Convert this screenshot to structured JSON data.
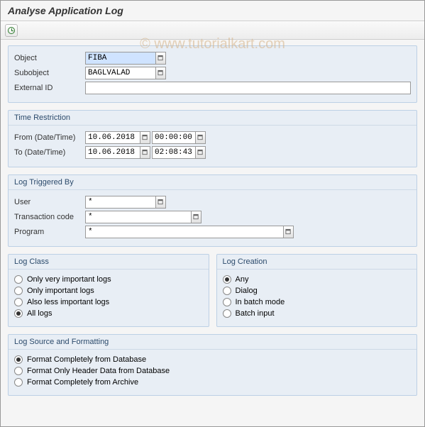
{
  "title": "Analyse Application Log",
  "watermark": "© www.tutorialkart.com",
  "fields": {
    "object_label": "Object",
    "object_value": "FIBA",
    "subobject_label": "Subobject",
    "subobject_value": "BAGLVALAD",
    "external_id_label": "External ID",
    "external_id_value": ""
  },
  "time": {
    "section": "Time Restriction",
    "from_label": "From (Date/Time)",
    "from_date": "10.06.2018",
    "from_time": "00:00:00",
    "to_label": "To (Date/Time)",
    "to_date": "10.06.2018",
    "to_time": "02:08:43"
  },
  "triggered": {
    "section": "Log Triggered By",
    "user_label": "User",
    "user_value": "*",
    "tx_label": "Transaction code",
    "tx_value": "*",
    "prog_label": "Program",
    "prog_value": "*"
  },
  "log_class": {
    "section": "Log Class",
    "o1": "Only very important logs",
    "o2": "Only important logs",
    "o3": "Also less important logs",
    "o4": "All logs",
    "selected": "o4"
  },
  "log_creation": {
    "section": "Log Creation",
    "o1": "Any",
    "o2": "Dialog",
    "o3": "In batch mode",
    "o4": "Batch input",
    "selected": "o1"
  },
  "source": {
    "section": "Log Source and Formatting",
    "o1": "Format Completely from Database",
    "o2": "Format Only Header Data from Database",
    "o3": "Format Completely from Archive",
    "selected": "o1"
  }
}
